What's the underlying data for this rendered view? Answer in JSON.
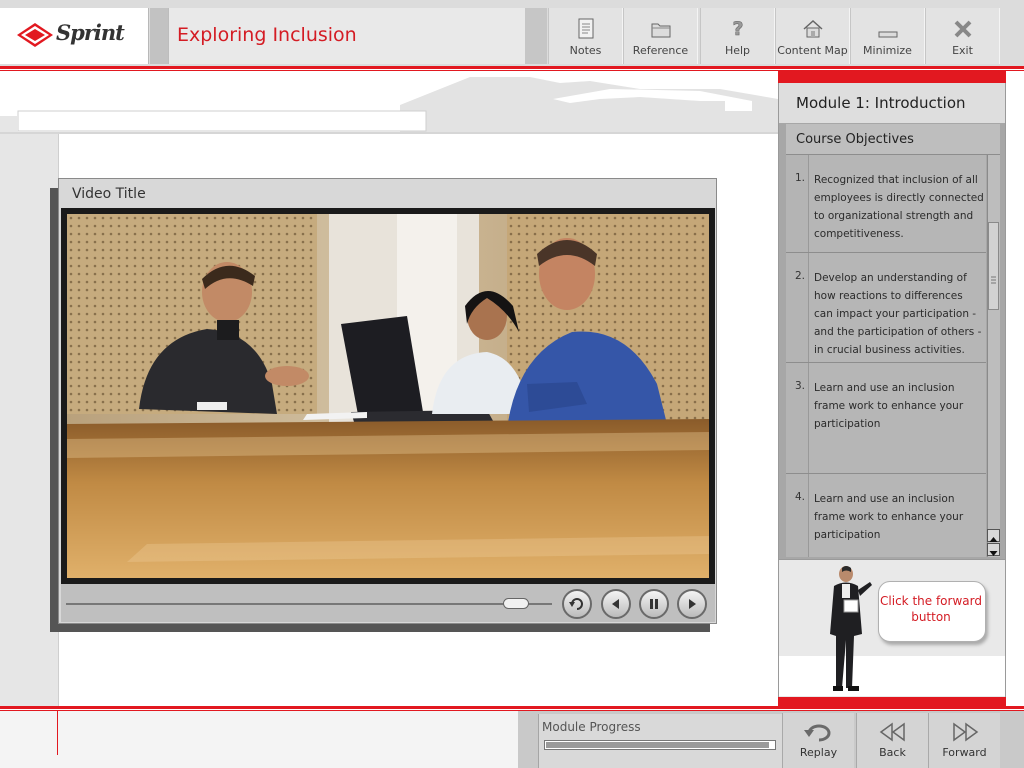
{
  "brand": {
    "logo_text": "Sprint",
    "accent_color": "#e21820"
  },
  "header": {
    "course_title": "Exploring Inclusion"
  },
  "toolbar": {
    "notes": {
      "label": "Notes",
      "icon": "notes-icon"
    },
    "reference": {
      "label": "Reference",
      "icon": "folder-icon"
    },
    "help": {
      "label": "Help",
      "icon": "help-icon"
    },
    "content_map": {
      "label": "Content Map",
      "icon": "house-icon"
    },
    "minimize": {
      "label": "Minimize",
      "icon": "minimize-icon"
    },
    "exit": {
      "label": "Exit",
      "icon": "close-icon"
    }
  },
  "video": {
    "title": "Video Title",
    "scene": "meeting-photo",
    "controls": {
      "replay": {
        "icon": "replay-icon"
      },
      "previous": {
        "icon": "previous-icon"
      },
      "pause": {
        "icon": "pause-icon"
      },
      "next": {
        "icon": "play-icon"
      }
    }
  },
  "sidebar": {
    "module_title": "Module 1: Introduction",
    "section_title": "Course Objectives",
    "objectives": [
      {
        "number": "1.",
        "text": "Recognized that inclusion of all employees is directly connected to organizational strength and competitiveness."
      },
      {
        "number": "2.",
        "text": "Develop an understanding of how reactions to differences can impact your participation - and the participation of others - in crucial business activities."
      },
      {
        "number": "3.",
        "text": "Learn and use an inclusion frame work to enhance your participation"
      },
      {
        "number": "4.",
        "text": "Learn and use an inclusion frame work to enhance your participation"
      }
    ],
    "hint_text": "Click the forward button"
  },
  "footer": {
    "progress_label": "Module Progress",
    "progress_value": 0.98,
    "replay_label": "Replay",
    "back_label": "Back",
    "forward_label": "Forward"
  }
}
